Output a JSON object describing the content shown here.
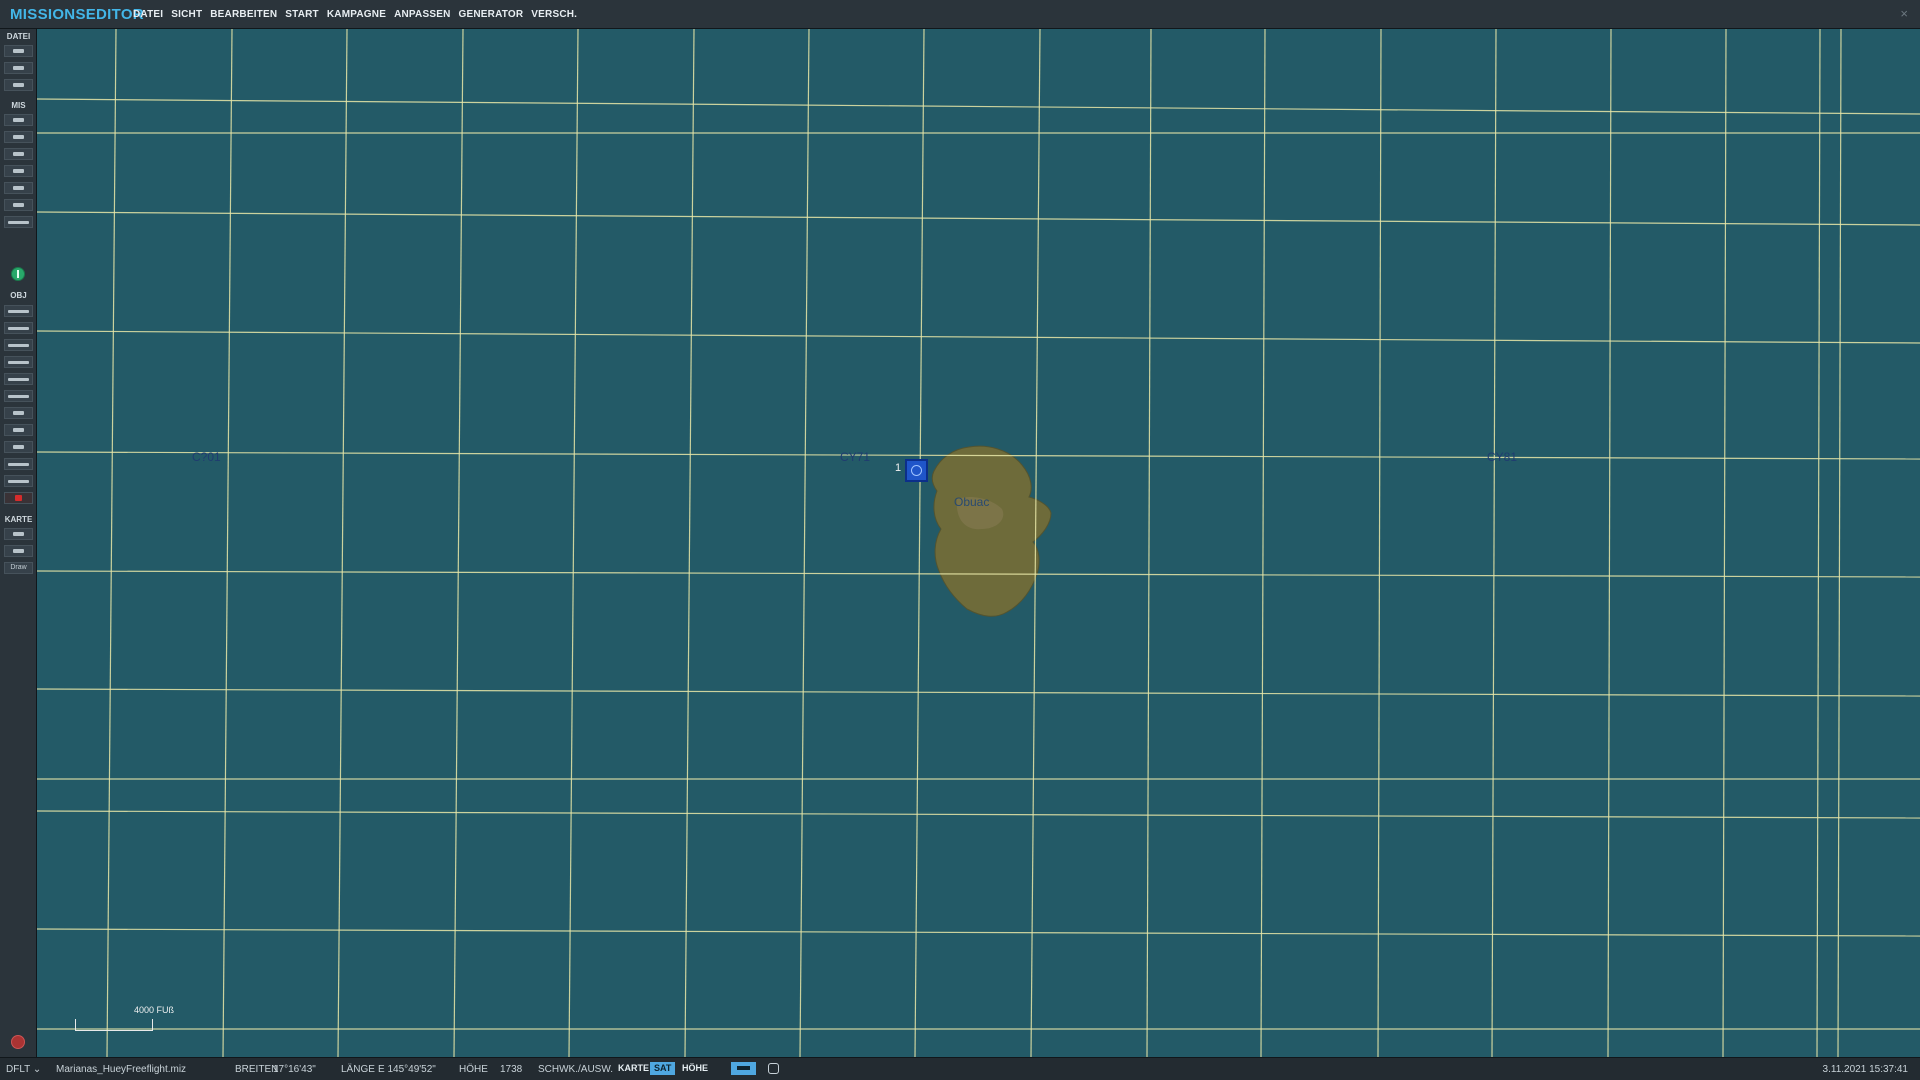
{
  "app": {
    "title": "MISSIONSEDITOR",
    "close_glyph": "×"
  },
  "menu": [
    "DATEI",
    "SICHT",
    "BEARBEITEN",
    "START",
    "KAMPAGNE",
    "ANPASSEN",
    "GENERATOR",
    "VERSCH."
  ],
  "sidebar": {
    "sections": [
      "DATEI",
      "MIS",
      "OBJ",
      "KARTE"
    ],
    "draw_label": "Draw",
    "icons": {
      "datei": [
        "new-mission-icon",
        "open-icon",
        "save-icon"
      ],
      "mis": [
        "briefing-icon",
        "weather-icon",
        "trigger-icon",
        "goals-icon",
        "options-icon",
        "check-icon",
        "coalition-icon"
      ],
      "globe": "globe-icon",
      "obj": [
        "plane-icon",
        "helicopter-icon",
        "ship-icon",
        "vehicle-icon",
        "static-object-icon",
        "template-icon",
        "airfield-icon",
        "zone-icon",
        "target-icon",
        "group-icon",
        "shapes-icon",
        "delete-icon"
      ],
      "karte": [
        "key-icon",
        "ruler-icon"
      ]
    }
  },
  "map": {
    "background_color": "#235a67",
    "grid_color": "#e9e8a8",
    "markers": [
      "C?01",
      "CY71",
      "CY81"
    ],
    "island_name": "Obuac",
    "unit_number": "1",
    "scale_label": "4000 FUß"
  },
  "status": {
    "profile": "DFLT",
    "profile_dropdown": "⌄",
    "filename": "Marianas_HueyFreeflight.miz",
    "lat_label": "BREITEN",
    "lat_value": "17°16'43\"",
    "lon_label": "LÄNGE",
    "lon_value": "E 145°49'52\"",
    "alt_label": "HÖHE",
    "alt_value": "1738",
    "toggle_label": "SCHWK./AUSW.",
    "karte": "KARTE",
    "sat": "SAT",
    "hoehe": "HÖHE",
    "datetime": "3.11.2021 15:37:41"
  }
}
